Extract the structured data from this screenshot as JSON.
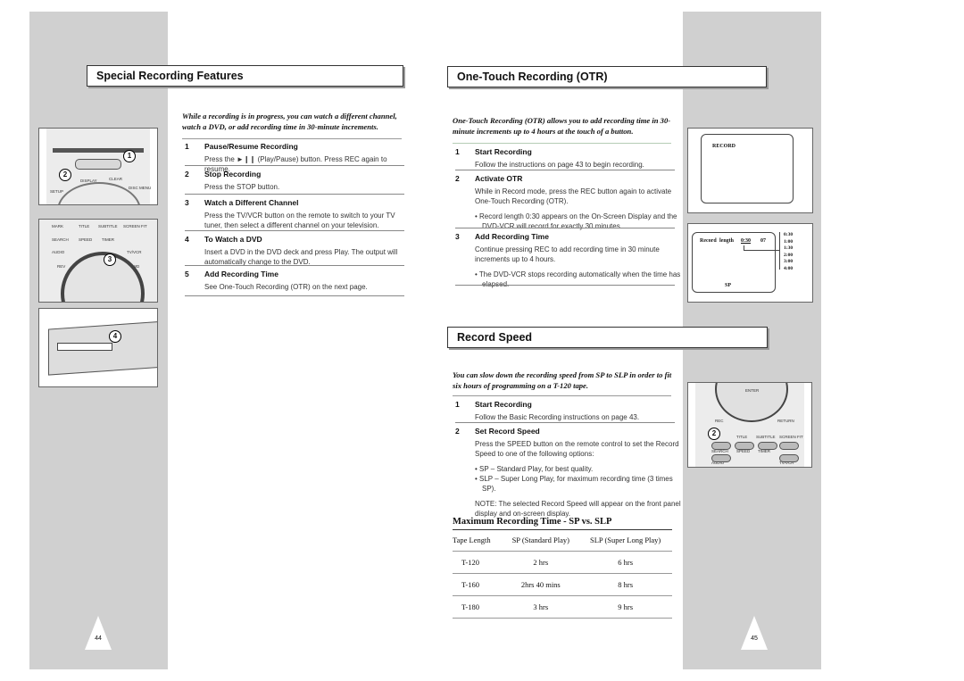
{
  "left_page": {
    "title": "Special Recording Features",
    "intro": "While a recording is in progress, you can watch a different channel, watch a DVD, or add recording time in 30-minute increments.",
    "steps": [
      {
        "num": "1",
        "heading": "Pause/Resume Recording",
        "text": "Press the ►❙❙ (Play/Pause) button. Press REC again to resume."
      },
      {
        "num": "2",
        "heading": "Stop Recording",
        "text": "Press the STOP button."
      },
      {
        "num": "3",
        "heading": "Watch a Different Channel",
        "text": "Press the TV/VCR button on the remote to switch to your TV tuner, then select a different channel on your television."
      },
      {
        "num": "4",
        "heading": "To Watch a DVD",
        "text": "Insert a DVD in the DVD deck and press Play. The output will automatically change to the DVD."
      },
      {
        "num": "5",
        "heading": "Add Recording Time",
        "text": "See One-Touch Recording (OTR) on the next page."
      }
    ],
    "illustrations": {
      "remote1_labels": [
        "DISPLAY",
        "CLEAR",
        "SETUP",
        "DISC MENU"
      ],
      "remote1_callouts": [
        "1",
        "2"
      ],
      "remote2_labels": [
        "MARK",
        "TITLE",
        "SUBTITLE",
        "SCREEN FIT",
        "SEARCH",
        "SPEED",
        "TIMER",
        "AUDIO",
        "TV/VCR",
        "REV",
        "FWD"
      ],
      "remote2_callout": "3",
      "deck_callout": "4"
    },
    "page_number": "44"
  },
  "right_page": {
    "otr": {
      "title": "One-Touch Recording (OTR)",
      "intro": "One-Touch Recording (OTR) allows you to add recording time in 30-minute increments up to 4 hours at the touch of a button.",
      "steps": [
        {
          "num": "1",
          "heading": "Start Recording",
          "text": "Follow the instructions on page 43 to begin recording."
        },
        {
          "num": "2",
          "heading": "Activate OTR",
          "text": "While in Record mode, press the REC button again to activate One-Touch Recording (OTR).",
          "bullet": "Record length 0:30 appears on the On-Screen Display and the DVD-VCR will record for exactly 30 minutes."
        },
        {
          "num": "3",
          "heading": "Add Recording Time",
          "text": "Continue pressing REC to add recording time in 30 minute increments up to 4 hours.",
          "bullet": "The DVD-VCR stops recording automatically when the time has elapsed."
        }
      ],
      "osd1": {
        "text": "RECORD"
      },
      "osd2": {
        "record_label": "Record",
        "length_label": "length",
        "length_value": "0:30",
        "channel": "07",
        "speed": "SP",
        "options": [
          "0:30",
          "1:00",
          "1:30",
          "2:00",
          "3:00",
          "4:00"
        ]
      }
    },
    "record_speed": {
      "title": "Record Speed",
      "intro": "You can slow down the recording speed from SP to SLP in order to fit six hours of programming on a T-120 tape.",
      "steps": [
        {
          "num": "1",
          "heading": "Start Recording",
          "text": "Follow the Basic Recording instructions on page 43."
        },
        {
          "num": "2",
          "heading": "Set Record Speed",
          "text": "Press the SPEED button on the remote control to set the Record Speed to one of the following options:",
          "bullets": [
            "SP – Standard Play, for best quality.",
            "SLP – Super Long Play, for maximum recording time (3 times SP)."
          ],
          "note": "NOTE: The selected Record Speed will appear on the front panel display and on-screen display."
        }
      ],
      "table_title": "Maximum Recording Time - SP vs. SLP",
      "table_headers": [
        "Tape Length",
        "SP (Standard Play)",
        "SLP (Super Long Play)"
      ],
      "table_rows": [
        [
          "T-120",
          "2 hrs",
          "6 hrs"
        ],
        [
          "T-160",
          "2hrs 40 mins",
          "8 hrs"
        ],
        [
          "T-180",
          "3 hrs",
          "9 hrs"
        ]
      ],
      "remote_labels": [
        "ENTER",
        "REC",
        "RETURN",
        "TITLE",
        "SUBTITLE",
        "SCREEN FIT",
        "SEARCH",
        "SPEED",
        "TIMER",
        "AUDIO",
        "TV/VCR"
      ],
      "remote_callout": "2"
    },
    "page_number": "45"
  }
}
